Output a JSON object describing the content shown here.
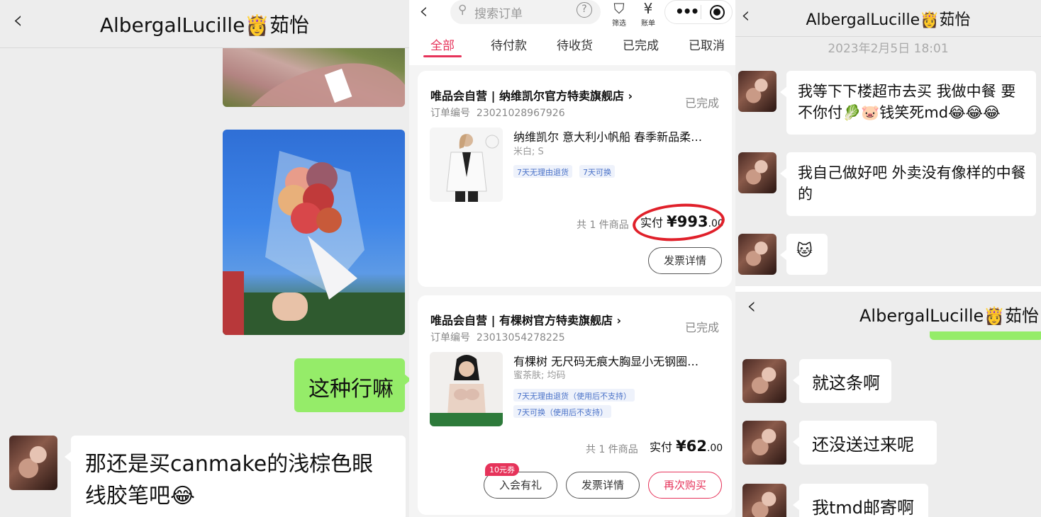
{
  "left": {
    "back_icon": "chevron-left-icon",
    "title": "AlbergalLucille👸茹怡",
    "messages": {
      "sent_text": "这种行嘛",
      "received_text": "那还是买canmake的浅棕色眼线胶笔吧😂"
    },
    "colors": {
      "sent_bubble": "#95ec69",
      "received_bubble": "#ffffff"
    }
  },
  "mid": {
    "search_placeholder": "搜索订单",
    "help_icon": "question-circle-icon",
    "filter_label": "筛选",
    "bill_label": "账单",
    "more_icon": "more-dots-icon",
    "target_icon": "target-icon",
    "tabs": [
      {
        "label": "全部",
        "active": true
      },
      {
        "label": "待付款",
        "active": false
      },
      {
        "label": "待收货",
        "active": false
      },
      {
        "label": "已完成",
        "active": false
      },
      {
        "label": "已取消",
        "active": false
      }
    ],
    "orders": [
      {
        "store": "唯品会自营 | 纳维凯尔官方特卖旗舰店 ›",
        "order_no_label": "订单编号",
        "order_no": "23021028967926",
        "status": "已完成",
        "product_name": "纳维凯尔 意大利小帆船 春季新品柔…",
        "spec": "米白; S",
        "tags": [
          "7天无理由退货",
          "7天可换"
        ],
        "count_text": "共 1 件商品",
        "paid_label": "实付",
        "paid_amount": "¥993",
        "paid_cents": ".00",
        "buttons": [
          "发票详情"
        ]
      },
      {
        "store": "唯品会自营 | 有棵树官方特卖旗舰店 ›",
        "order_no_label": "订单编号",
        "order_no": "23013054278225",
        "status": "已完成",
        "product_name": "有棵树 无尺码无痕大胸显小无钢圈…",
        "spec": "蜜茶肤; 均码",
        "tags": [
          "7天无理由退货（使用后不支持）",
          "7天可换（使用后不支持）"
        ],
        "count_text": "共 1 件商品",
        "paid_label": "实付",
        "paid_amount": "¥62",
        "paid_cents": ".00",
        "coupon": "10元券",
        "buttons": [
          "入会有礼",
          "发票详情",
          "再次购买"
        ]
      }
    ],
    "accent": "#e6335a"
  },
  "right": {
    "title": "AlbergalLucille👸茹怡",
    "date": "2023年2月5日 18:01",
    "messages_top": [
      "我等下下楼超市去买 我做中餐 要不你付🥬🐷钱笑死md😂😂😂",
      "我自己做好吧 外卖没有像样的中餐的",
      "🐱"
    ],
    "title2": "AlbergalLucille👸茹怡",
    "messages_bottom": [
      "就这条啊",
      "还没送过来呢",
      "我tmd邮寄啊"
    ]
  }
}
